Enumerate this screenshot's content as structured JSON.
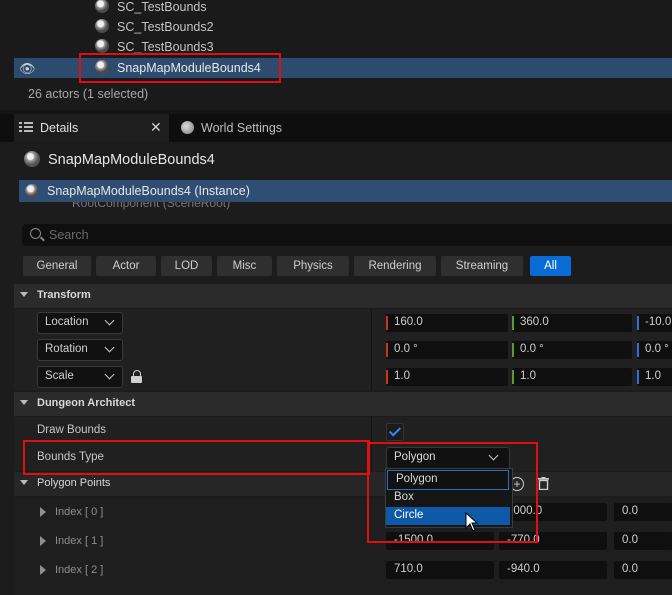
{
  "outliner": {
    "items": [
      {
        "label": "SC_TestBounds"
      },
      {
        "label": "SC_TestBounds2"
      },
      {
        "label": "SC_TestBounds3"
      },
      {
        "label": "SnapMapModuleBounds4"
      }
    ],
    "count_text": "26 actors (1 selected)"
  },
  "tabs": [
    {
      "label": "Details"
    },
    {
      "label": "World Settings"
    }
  ],
  "details": {
    "actor_name": "SnapMapModuleBounds4",
    "component_selected": "SnapMapModuleBounds4 (Instance)",
    "component_next": "RootComponent (SceneRoot)",
    "search_placeholder": "Search",
    "filters": [
      "General",
      "Actor",
      "LOD",
      "Misc",
      "Physics",
      "Rendering",
      "Streaming",
      "All"
    ],
    "active_filter": "All"
  },
  "transform": {
    "title": "Transform",
    "location": {
      "label": "Location",
      "x": "160.0",
      "y": "360.0",
      "z": "-10.0"
    },
    "rotation": {
      "label": "Rotation",
      "x": "0.0 °",
      "y": "0.0 °",
      "z": "0.0 °"
    },
    "scale": {
      "label": "Scale",
      "x": "1.0",
      "y": "1.0",
      "z": "1.0"
    }
  },
  "dungeon": {
    "title": "Dungeon Architect",
    "draw_bounds_label": "Draw Bounds",
    "draw_bounds_checked": true,
    "bounds_type_label": "Bounds Type",
    "bounds_type_value": "Polygon",
    "options": [
      "Polygon",
      "Box",
      "Circle"
    ],
    "hovered_option": "Circle"
  },
  "polygon": {
    "title": "Polygon Points",
    "rows": [
      {
        "index": "Index [ 0 ]",
        "x": "1000.0",
        "y": "0.0"
      },
      {
        "index": "Index [ 1 ]",
        "x": "-1500.0",
        "y": "-770.0",
        "z": "0.0"
      },
      {
        "index": "Index [ 2 ]",
        "x": "710.0",
        "y": "-940.0",
        "z": "0.0"
      }
    ]
  },
  "colors": {
    "accent": "#0a6bd6",
    "selection": "#2d4b6e",
    "highlight_box": "#e01010",
    "axis_x": "#c8341c",
    "axis_y": "#5a9e2a",
    "axis_z": "#2f6fd6"
  }
}
